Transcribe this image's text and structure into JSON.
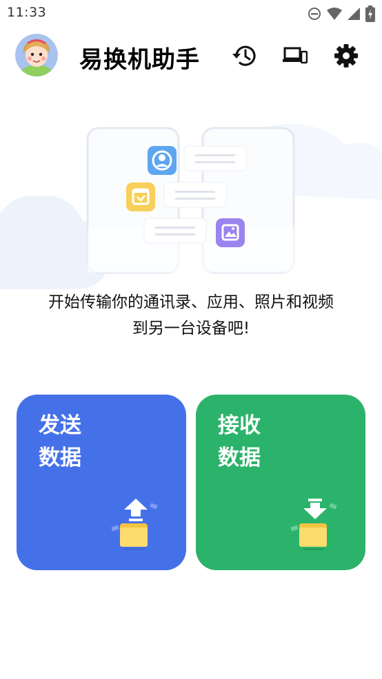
{
  "status_bar": {
    "time": "11:33",
    "icons": [
      "do-not-disturb-icon",
      "wifi-icon",
      "signal-icon",
      "battery-charging-icon"
    ]
  },
  "header": {
    "title": "易换机助手",
    "actions": [
      "history-icon",
      "devices-icon",
      "settings-icon"
    ]
  },
  "illustration": {
    "items": [
      "contact-icon",
      "calendar-icon",
      "photo-icon"
    ]
  },
  "intro": {
    "line1": "开始传输你的通讯录、应用、照片和视频",
    "line2": "到另一台设备吧!"
  },
  "cards": {
    "send": {
      "line1": "发送",
      "line2": "数据",
      "icon": "folder-upload-icon"
    },
    "receive": {
      "line1": "接收",
      "line2": "数据",
      "icon": "folder-download-icon"
    }
  },
  "colors": {
    "send": "#4571e8",
    "receive": "#2cb36b",
    "contact": "#5ea6f0",
    "calendar": "#f7cf5a",
    "photo": "#9a84ef"
  }
}
